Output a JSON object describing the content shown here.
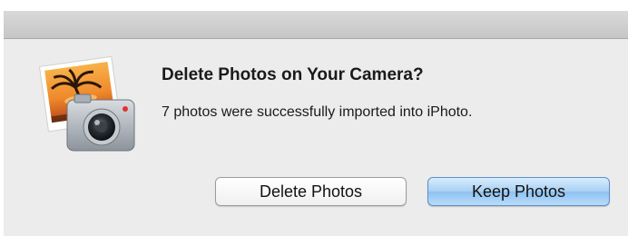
{
  "dialog": {
    "title": "Delete Photos on Your Camera?",
    "message": "7 photos were successfully imported into iPhoto.",
    "icon": "iphoto-app-icon"
  },
  "buttons": {
    "delete_label": "Delete Photos",
    "keep_label": "Keep Photos"
  },
  "colors": {
    "dialog_background": "#ececec",
    "default_button": "#a8d0f4"
  }
}
